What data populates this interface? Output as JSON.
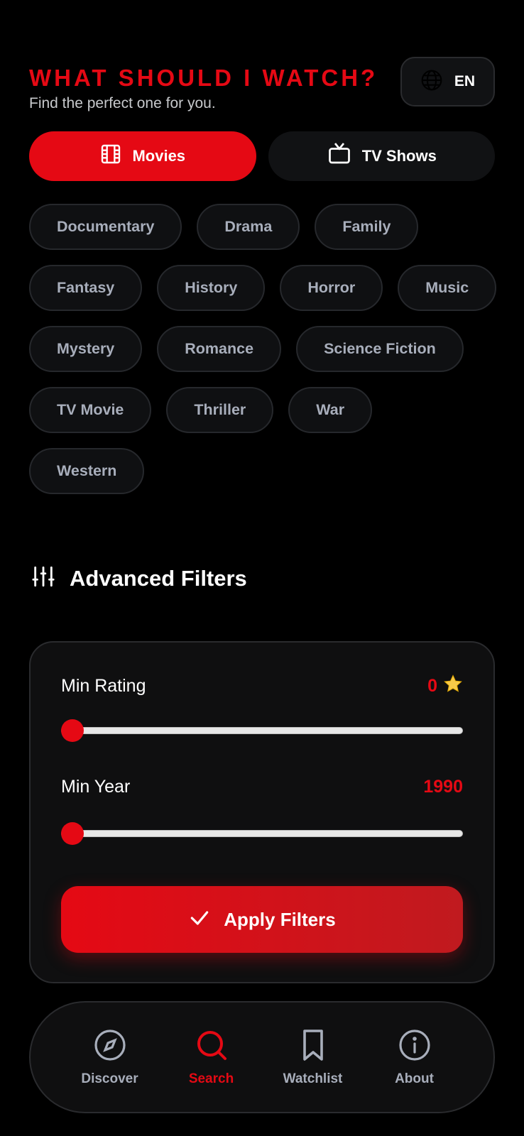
{
  "header": {
    "title": "WHAT SHOULD I WATCH?",
    "subtitle": "Find the perfect one for you.",
    "language_label": "EN"
  },
  "type_toggle": {
    "movies_label": "Movies",
    "tv_label": "TV Shows",
    "active": "movies"
  },
  "genres": [
    "Documentary",
    "Drama",
    "Family",
    "Fantasy",
    "History",
    "Horror",
    "Music",
    "Mystery",
    "Romance",
    "Science Fiction",
    "TV Movie",
    "Thriller",
    "War",
    "Western"
  ],
  "advanced_filters": {
    "title": "Advanced Filters",
    "min_rating": {
      "label": "Min Rating",
      "value": "0",
      "level": 0
    },
    "min_year": {
      "label": "Min Year",
      "value": "1990",
      "level": 0
    },
    "apply_label": "Apply Filters"
  },
  "nav": {
    "items": [
      {
        "label": "Discover",
        "icon": "compass-icon"
      },
      {
        "label": "Search",
        "icon": "search-icon"
      },
      {
        "label": "Watchlist",
        "icon": "bookmark-icon"
      },
      {
        "label": "About",
        "icon": "info-icon"
      }
    ],
    "active": "Search"
  },
  "colors": {
    "accent": "#e50914",
    "background": "#000000",
    "chip_text": "#a8aebb"
  }
}
